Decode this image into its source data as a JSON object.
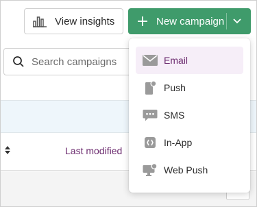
{
  "toolbar": {
    "insights_label": "View insights",
    "new_campaign_label": "New campaign"
  },
  "search": {
    "placeholder": "Search campaigns"
  },
  "table": {
    "column_last_modified": "Last modified"
  },
  "menu": {
    "items": [
      {
        "label": "Email",
        "icon": "envelope-icon",
        "active": true
      },
      {
        "label": "Push",
        "icon": "phone-notification-icon"
      },
      {
        "label": "SMS",
        "icon": "chat-bubble-icon"
      },
      {
        "label": "In-App",
        "icon": "in-app-icon"
      },
      {
        "label": "Web Push",
        "icon": "monitor-notification-icon"
      }
    ]
  },
  "colors": {
    "primary": "#3f9b6b",
    "accent": "#6b2a6e",
    "icon": "#9a9a9a",
    "active_bg": "#f6eef8"
  }
}
